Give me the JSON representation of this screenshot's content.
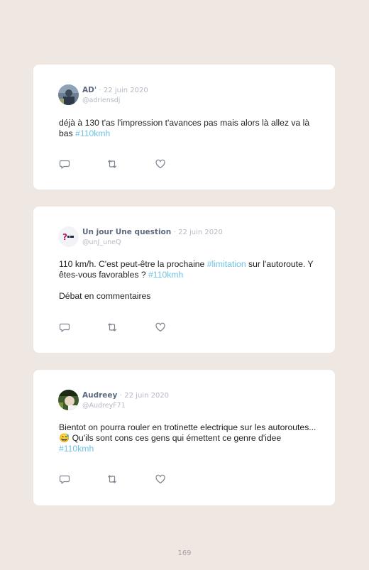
{
  "tweets": [
    {
      "name": "AD'",
      "separator": "·",
      "date": "22 juin 2020",
      "handle": "@adriensdj",
      "text_parts": [
        "déjà à 130 t'as l'impression t'avances pas mais alors là allez va là bas ",
        "#110kmh"
      ]
    },
    {
      "name": "Un jour Une question",
      "separator": "·",
      "date": "22 juin 2020",
      "handle": "@unJ_uneQ",
      "text_parts": [
        "110 km/h. C'est peut-être la prochaine ",
        "#limitation",
        " sur l'autoroute. Y êtes-vous favorables ? ",
        "#110kmh",
        "Débat en commentaires"
      ]
    },
    {
      "name": "Audreey",
      "separator": "·",
      "date": "22 juin 2020",
      "handle": "@AudreyF71",
      "text_parts": [
        "Bientot on pourra rouler en trotinette electrique sur les autoroutes... ",
        "😅",
        " Qu'ils sont cons ces gens qui émettent ce genre d'idee ",
        "#110kmh"
      ]
    }
  ],
  "icons": [
    "reply-icon",
    "retweet-icon",
    "like-icon"
  ],
  "colors": {
    "background": "#efe7e2",
    "card": "#ffffff",
    "hashtag": "#6ec3e6",
    "name": "#5d6a7e",
    "meta": "#b3b9c3"
  },
  "page_number": "169"
}
